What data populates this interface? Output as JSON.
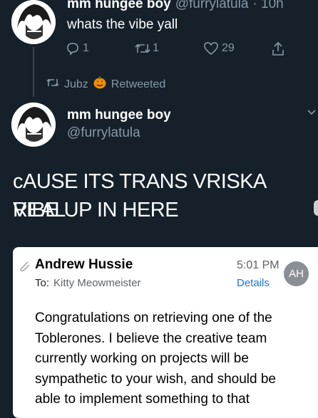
{
  "tweet1": {
    "name": "mm hungee boy",
    "handle": "@furrylatula",
    "time": "· 10h",
    "text": "whats the vibe yall",
    "reply_count": "1",
    "retweet_count": "1",
    "like_count": "29"
  },
  "retweet_banner": {
    "user": "Jubz",
    "label": "Retweeted"
  },
  "tweet2": {
    "name": "mm hungee boy",
    "handle": "@furrylatula",
    "text_line1": "cAUSE ITS TRANS VRISKA REAL",
    "text_line2": "VIBE UP IN HERE"
  },
  "email": {
    "sender": "Andrew Hussie",
    "time": "5:01 PM",
    "to_label": "To:",
    "to_name": "Kitty Meowmeister",
    "details_label": "Details",
    "avatar_initials": "AH",
    "body_lines": [
      "Congratulations on retrieving one of the",
      "Toblerones. I believe the creative team",
      "currently working on projects will be",
      "sympathetic to your wish, and should be",
      "able to implement something to that"
    ]
  },
  "colors": {
    "background": "#15202b",
    "secondary_text": "#8899a6",
    "link_blue": "#1a73e8"
  }
}
